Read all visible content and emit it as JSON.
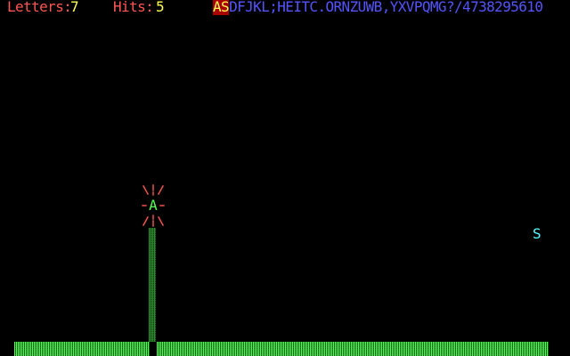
{
  "hud": {
    "letters_label": "Letters:",
    "letters_value": "7",
    "hits_label": "Hits:",
    "hits_value": "5"
  },
  "sequence": {
    "typed": "AS",
    "remaining": "DFJKL;HEITC.ORNZUWB,YXVPQMG?/4738295610"
  },
  "targets": {
    "hit_letter": "A",
    "falling_letter": "S"
  },
  "colors": {
    "label": "#ff5555",
    "value": "#ffff55",
    "sequence": "#5555ff",
    "typed_bg": "#aa0000",
    "hit_letter": "#55ff55",
    "falling_letter": "#55ffff",
    "burst": "#ff5555",
    "ground": "#55ff55"
  },
  "icons": {
    "burst": "explosion-icon"
  }
}
